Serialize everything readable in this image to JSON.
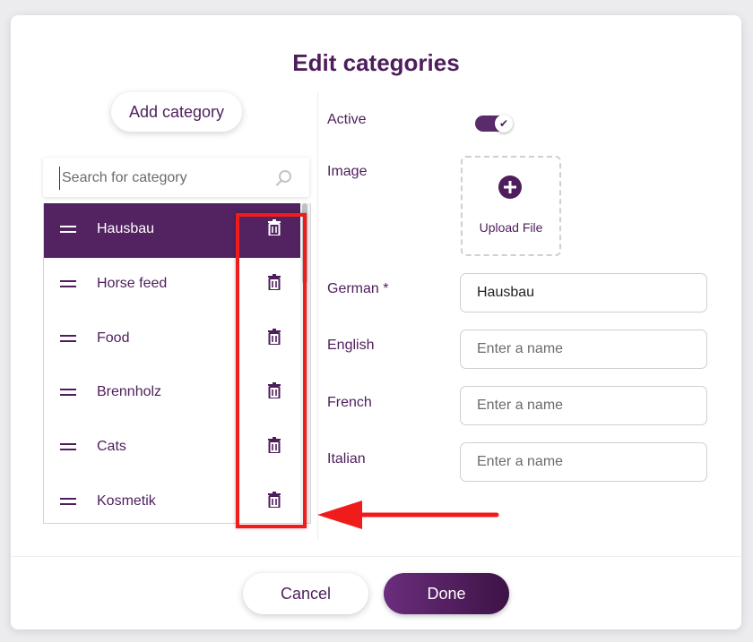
{
  "dialog": {
    "title": "Edit categories",
    "add_category_label": "Add category",
    "search_placeholder": "Search for category",
    "categories": [
      {
        "name": "Hausbau",
        "selected": true
      },
      {
        "name": "Horse feed",
        "selected": false
      },
      {
        "name": "Food",
        "selected": false
      },
      {
        "name": "Brennholz",
        "selected": false
      },
      {
        "name": "Cats",
        "selected": false
      },
      {
        "name": "Kosmetik",
        "selected": false
      }
    ],
    "form": {
      "active_label": "Active",
      "active_value": true,
      "image_label": "Image",
      "upload_label": "Upload File",
      "german_label": "German *",
      "german_value": "Hausbau",
      "english_label": "English",
      "french_label": "French",
      "italian_label": "Italian",
      "name_placeholder": "Enter a name"
    },
    "cancel_label": "Cancel",
    "done_label": "Done"
  },
  "colors": {
    "brand_purple": "#522360",
    "title_purple": "#4e1e5c",
    "annotation_red": "#f01c1c"
  },
  "icons": {
    "drag": "drag-handle-icon",
    "delete": "trash-icon",
    "search": "search-icon",
    "upload": "plus-circle-icon",
    "check": "check-icon"
  }
}
